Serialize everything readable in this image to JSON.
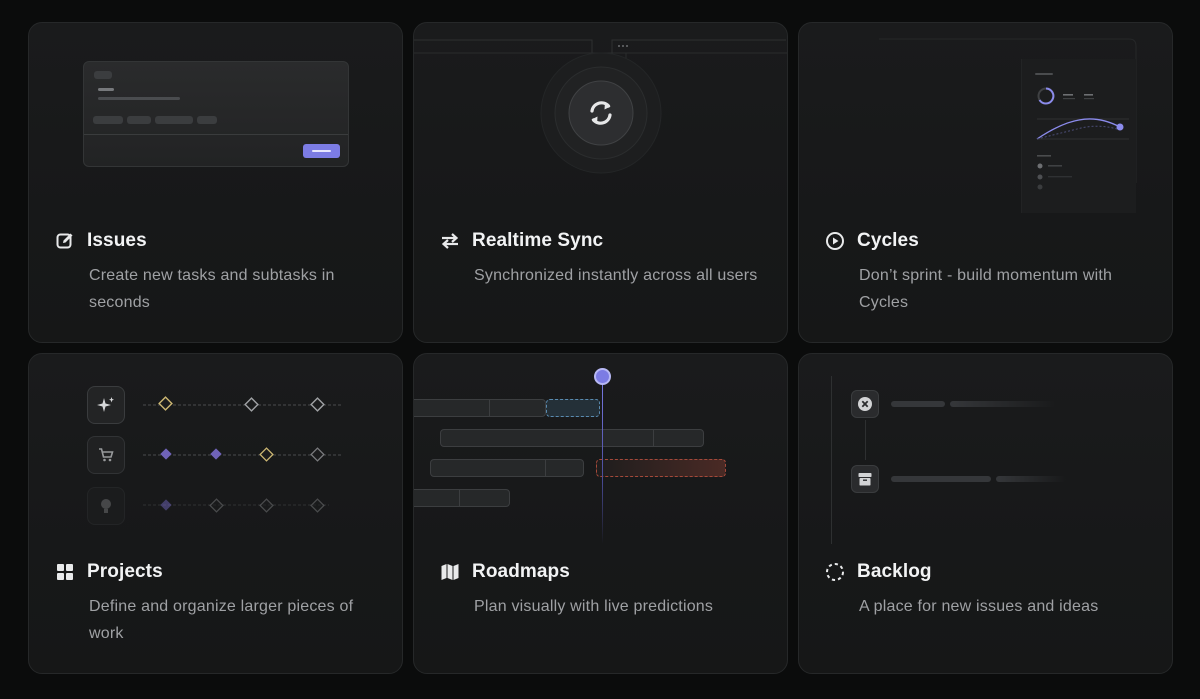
{
  "cards": [
    {
      "id": "issues",
      "icon": "edit-square-icon",
      "title": "Issues",
      "description": "Create new tasks and subtasks in seconds"
    },
    {
      "id": "realtime-sync",
      "icon": "arrows-exchange-icon",
      "title": "Realtime Sync",
      "description": "Synchronized instantly across all users"
    },
    {
      "id": "cycles",
      "icon": "play-circle-icon",
      "title": "Cycles",
      "description": "Don’t sprint - build momentum with Cycles"
    },
    {
      "id": "projects",
      "icon": "grid-squares-icon",
      "title": "Projects",
      "description": "Define and organize larger pieces of work"
    },
    {
      "id": "roadmaps",
      "icon": "map-icon",
      "title": "Roadmaps",
      "description": "Plan visually with live predictions"
    },
    {
      "id": "backlog",
      "icon": "dashed-circle-icon",
      "title": "Backlog",
      "description": "A place for new issues and ideas"
    }
  ],
  "colors": {
    "accent": "#7c7ce4",
    "milestone_yellow": "#cdb873",
    "milestone_purple": "#6f63b8",
    "danger_red": "#b4503e",
    "info_blue": "#5a8bb0"
  }
}
